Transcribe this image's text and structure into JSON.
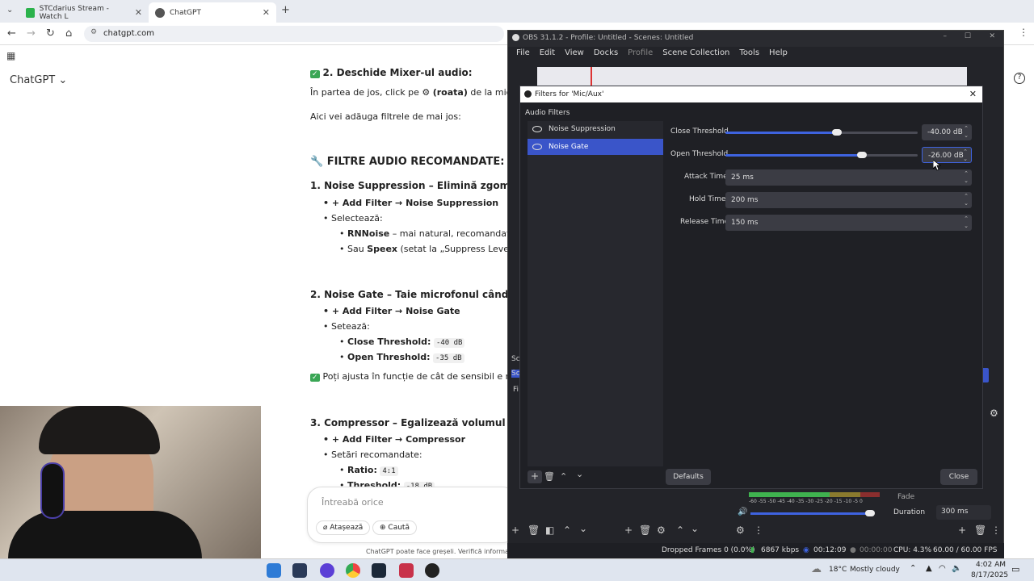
{
  "browser": {
    "tabs": [
      {
        "label": "STCdarius Stream - Watch L",
        "icon_color": "#2bb24c"
      },
      {
        "label": "ChatGPT",
        "icon_color": "#555555"
      }
    ],
    "url": "chatgpt.com",
    "new_tab": "+"
  },
  "chatgpt": {
    "brand": "ChatGPT",
    "lines": [
      "2. Deschide Mixer-ul audio:",
      "În partea de jos, click pe",
      "(roata)",
      "de la microfon -",
      "Aici vei adăuga filtrele de mai jos:",
      "FILTRE AUDIO RECOMANDATE:",
      "1. Noise Suppression – Elimină zgomotul de f",
      "+ Add Filter → Noise Suppression",
      "Selectează:",
      "RNNoise",
      "– mai natural, recomandat",
      "Sau",
      "Speex",
      "(setat la „Suppress Level: -30 dB",
      "2. Noise Gate – Taie microfonul când nu vorb",
      "+ Add Filter → Noise Gate",
      "Setează:",
      "Close Threshold:",
      "-40 dB",
      "Open Threshold:",
      "-35 dB",
      "Poți ajusta în funcție de cât de sensibil e microfo",
      "3. Compressor – Egalizează volumul vocii",
      "+ Add Filter → Compressor",
      "Setări recomandate:",
      "Ratio:",
      "4:1",
      "Threshold:",
      "-18 dB"
    ],
    "input_placeholder": "Întreabă orice",
    "attach_label": "Atașează",
    "search_label": "Caută",
    "disclaimer": "ChatGPT poate face greșeli. Verifică informațiile im"
  },
  "obs": {
    "title": "OBS 31.1.2 - Profile: Untitled - Scenes: Untitled",
    "menu": [
      "File",
      "Edit",
      "View",
      "Docks",
      "Profile",
      "Scene Collection",
      "Tools",
      "Help"
    ],
    "status": {
      "dropped": "Dropped Frames 0 (0.0%)",
      "kbps": "6867 kbps",
      "time1": "00:12:09",
      "time2": "00:00:00",
      "cpu": "CPU: 4.3%",
      "fps": "60.00 / 60.00 FPS"
    },
    "transition": {
      "fade": "Fade",
      "duration_label": "Duration",
      "duration_value": "300 ms"
    },
    "side_labels": [
      "Sc",
      "Sc",
      "Fi"
    ],
    "meter_ticks": [
      "-60",
      "-55",
      "-50",
      "-45",
      "-40",
      "-35",
      "-30",
      "-25",
      "-20",
      "-15",
      "-10",
      "-5",
      "0"
    ]
  },
  "filters_dialog": {
    "title": "Filters for 'Mic/Aux'",
    "section": "Audio Filters",
    "filters": [
      "Noise Suppression",
      "Noise Gate"
    ],
    "params": [
      {
        "label": "Close Threshold",
        "value": "-40.00 dB"
      },
      {
        "label": "Open Threshold",
        "value": "-26.00 dB"
      },
      {
        "label": "Attack Time",
        "value": "25 ms"
      },
      {
        "label": "Hold Time",
        "value": "200 ms"
      },
      {
        "label": "Release Time",
        "value": "150 ms"
      }
    ],
    "close_threshold_level": 0.58,
    "open_threshold_level": 0.71,
    "defaults_label": "Defaults",
    "close_label": "Close"
  },
  "taskbar": {
    "weather": "18°C",
    "weather_desc": "Mostly cloudy",
    "time": "4:02 AM",
    "date": "8/17/2025"
  }
}
